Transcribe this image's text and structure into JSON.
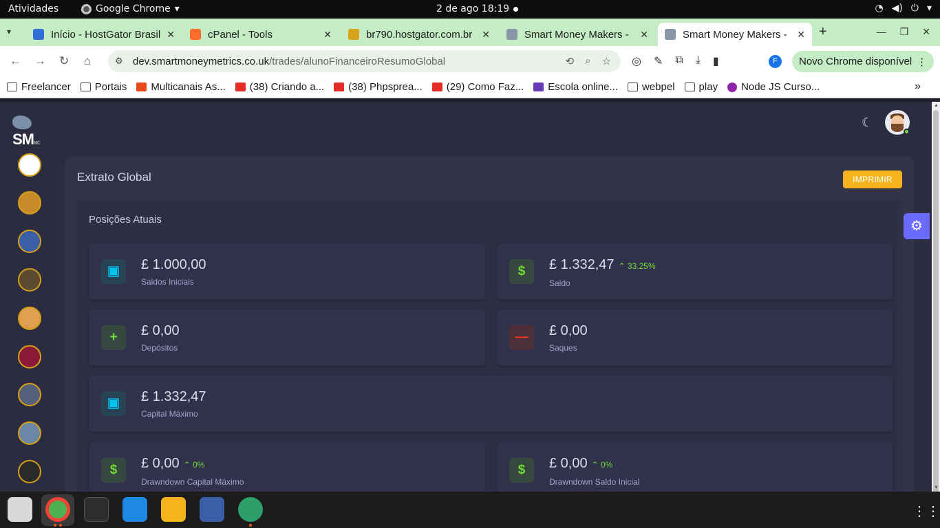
{
  "topbar": {
    "activities": "Atividades",
    "app_name": "Google Chrome",
    "clock": "2 de ago  18:19"
  },
  "tabs": [
    {
      "title": "Início - HostGator Brasil",
      "active": false
    },
    {
      "title": "cPanel - Tools",
      "active": false
    },
    {
      "title": "br790.hostgator.com.br",
      "active": false
    },
    {
      "title": "Smart Money Makers - ",
      "active": false
    },
    {
      "title": "Smart Money Makers - ",
      "active": true
    }
  ],
  "address_bar": {
    "host": "dev.smartmoneymetrics.co.uk",
    "path": "/trades/alunoFinanceiroResumoGlobal"
  },
  "profile_letter": "F",
  "new_chrome": "Novo Chrome disponível",
  "bookmarks": [
    {
      "label": "Freelancer",
      "icon": "folder"
    },
    {
      "label": "Portais",
      "icon": "folder"
    },
    {
      "label": "Multicanais As...",
      "icon": "b"
    },
    {
      "label": "(38) Criando a...",
      "icon": "yt"
    },
    {
      "label": "(38) Phpsprea...",
      "icon": "yt"
    },
    {
      "label": "(29) Como Faz...",
      "icon": "yt"
    },
    {
      "label": "Escola online...",
      "icon": "eo"
    },
    {
      "label": "webpel",
      "icon": "folder"
    },
    {
      "label": "play",
      "icon": "folder"
    },
    {
      "label": "Node JS Curso...",
      "icon": "node"
    }
  ],
  "app": {
    "logo_text": "SM",
    "logo_sub": "MC",
    "card_title": "Extrato Global",
    "print_button": "IMPRIMIR",
    "section_title": "Posições Atuais",
    "stats": [
      {
        "value": "£ 1.000,00",
        "label": "Saldos Iniciais",
        "icon": "money-icon",
        "color": "blue",
        "delta": ""
      },
      {
        "value": "£ 1.332,47",
        "label": "Saldo",
        "icon": "dollar-icon",
        "color": "green",
        "delta": "33.25%"
      },
      {
        "value": "£ 0,00",
        "label": "Depósitos",
        "icon": "plus-icon",
        "color": "green",
        "delta": ""
      },
      {
        "value": "£ 0,00",
        "label": "Saques",
        "icon": "minus-icon",
        "color": "red",
        "delta": ""
      },
      {
        "value": "£ 1.332,47",
        "label": "Capital Máximo",
        "icon": "money-icon",
        "color": "blue",
        "delta": ""
      },
      {
        "value": "£ 0,00",
        "label": "Drawndown Capital Máximo",
        "icon": "dollar-icon",
        "color": "green",
        "delta": "0%"
      },
      {
        "value": "£ 0,00",
        "label": "Drawndown Saldo Inicial",
        "icon": "dollar-icon",
        "color": "green",
        "delta": "0%"
      }
    ]
  },
  "colors": {
    "accent": "#696cff",
    "warning": "#f5b41d",
    "success": "#71dd37",
    "danger": "#ff3e1d",
    "info": "#03c3ec"
  }
}
